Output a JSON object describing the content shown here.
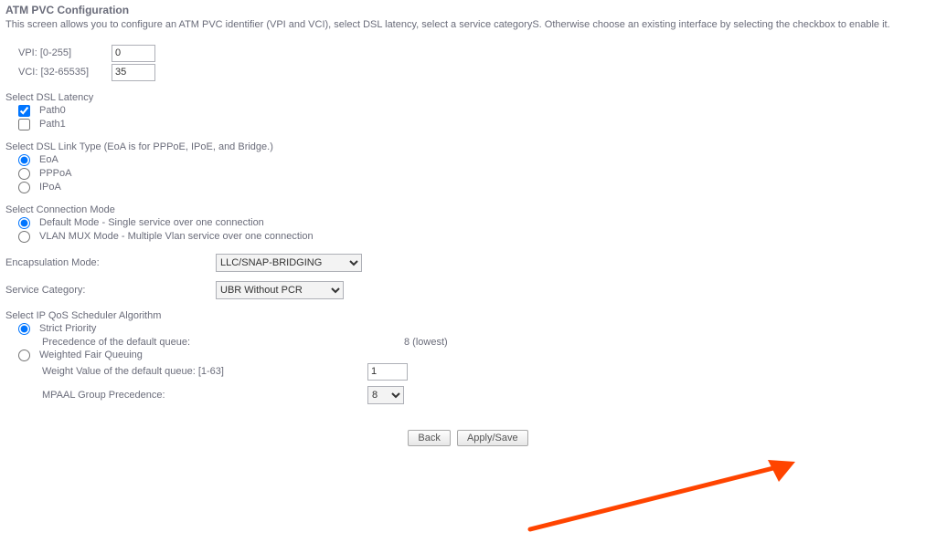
{
  "title": "ATM PVC Configuration",
  "description": "This screen allows you to configure an ATM PVC identifier (VPI and VCI), select DSL latency, select a service categoryS. Otherwise choose an existing interface by selecting the checkbox to enable it.",
  "vpi": {
    "label": "VPI: [0-255]",
    "value": "0"
  },
  "vci": {
    "label": "VCI: [32-65535]",
    "value": "35"
  },
  "dsl_latency": {
    "heading": "Select DSL Latency",
    "path0": "Path0",
    "path1": "Path1"
  },
  "dsl_link_type": {
    "heading": "Select DSL Link Type (EoA is for PPPoE, IPoE, and Bridge.)",
    "eoa": "EoA",
    "pppoa": "PPPoA",
    "ipoa": "IPoA"
  },
  "conn_mode": {
    "heading": "Select Connection Mode",
    "default": "Default Mode - Single service over one connection",
    "vlan": "VLAN MUX Mode - Multiple Vlan service over one connection"
  },
  "encapsulation": {
    "label": "Encapsulation Mode:",
    "selected": "LLC/SNAP-BRIDGING"
  },
  "service_category": {
    "label": "Service Category:",
    "selected": "UBR Without PCR"
  },
  "qos": {
    "heading": "Select IP QoS Scheduler Algorithm",
    "strict": "Strict Priority",
    "strict_prec_label": "Precedence of the default queue:",
    "strict_prec_value": "8 (lowest)",
    "wfq": "Weighted Fair Queuing",
    "wfq_weight_label": "Weight Value of the default queue: [1-63]",
    "wfq_weight_value": "1",
    "mpaal_label": "MPAAL Group Precedence:",
    "mpaal_value": "8"
  },
  "buttons": {
    "back": "Back",
    "apply": "Apply/Save"
  },
  "colors": {
    "arrow": "#ff4400"
  }
}
